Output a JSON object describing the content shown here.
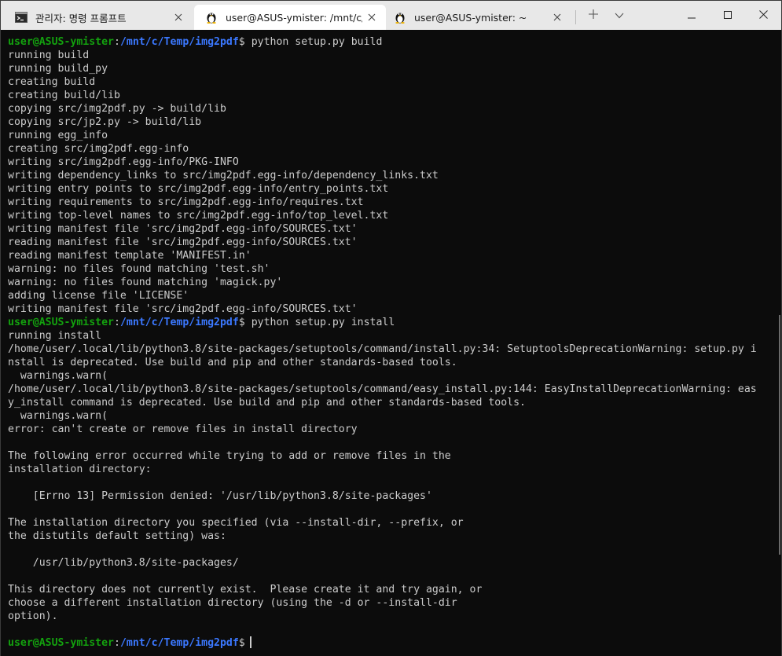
{
  "tabs": [
    {
      "title": "관리자: 명령 프롬프트",
      "icon": "cmd-icon",
      "active": false
    },
    {
      "title": "user@ASUS-ymister: /mnt/c/Te",
      "icon": "linux-penguin-icon",
      "active": true
    },
    {
      "title": "user@ASUS-ymister: ~",
      "icon": "linux-penguin-icon",
      "active": false
    }
  ],
  "new_tab": "+",
  "prompt": {
    "user": "user@ASUS-ymister",
    "colon": ":",
    "path": "/mnt/c/Temp/img2pdf",
    "dollar": "$"
  },
  "commands": {
    "build": " python setup.py build",
    "install": " python setup.py install"
  },
  "build_output": [
    "running build",
    "running build_py",
    "creating build",
    "creating build/lib",
    "copying src/img2pdf.py -> build/lib",
    "copying src/jp2.py -> build/lib",
    "running egg_info",
    "creating src/img2pdf.egg-info",
    "writing src/img2pdf.egg-info/PKG-INFO",
    "writing dependency_links to src/img2pdf.egg-info/dependency_links.txt",
    "writing entry points to src/img2pdf.egg-info/entry_points.txt",
    "writing requirements to src/img2pdf.egg-info/requires.txt",
    "writing top-level names to src/img2pdf.egg-info/top_level.txt",
    "writing manifest file 'src/img2pdf.egg-info/SOURCES.txt'",
    "reading manifest file 'src/img2pdf.egg-info/SOURCES.txt'",
    "reading manifest template 'MANIFEST.in'",
    "warning: no files found matching 'test.sh'",
    "warning: no files found matching 'magick.py'",
    "adding license file 'LICENSE'",
    "writing manifest file 'src/img2pdf.egg-info/SOURCES.txt'"
  ],
  "install_output": [
    "running install",
    "/home/user/.local/lib/python3.8/site-packages/setuptools/command/install.py:34: SetuptoolsDeprecationWarning: setup.py i",
    "nstall is deprecated. Use build and pip and other standards-based tools.",
    "  warnings.warn(",
    "/home/user/.local/lib/python3.8/site-packages/setuptools/command/easy_install.py:144: EasyInstallDeprecationWarning: eas",
    "y_install command is deprecated. Use build and pip and other standards-based tools.",
    "  warnings.warn(",
    "error: can't create or remove files in install directory",
    "",
    "The following error occurred while trying to add or remove files in the",
    "installation directory:",
    "",
    "    [Errno 13] Permission denied: '/usr/lib/python3.8/site-packages'",
    "",
    "The installation directory you specified (via --install-dir, --prefix, or",
    "the distutils default setting) was:",
    "",
    "    /usr/lib/python3.8/site-packages/",
    "",
    "This directory does not currently exist.  Please create it and try again, or",
    "choose a different installation directory (using the -d or --install-dir",
    "option).",
    ""
  ],
  "colors": {
    "prompt_user": "#13a10e",
    "prompt_path": "#3b78ff",
    "text": "#cccccc",
    "background": "#0c0c0c"
  }
}
